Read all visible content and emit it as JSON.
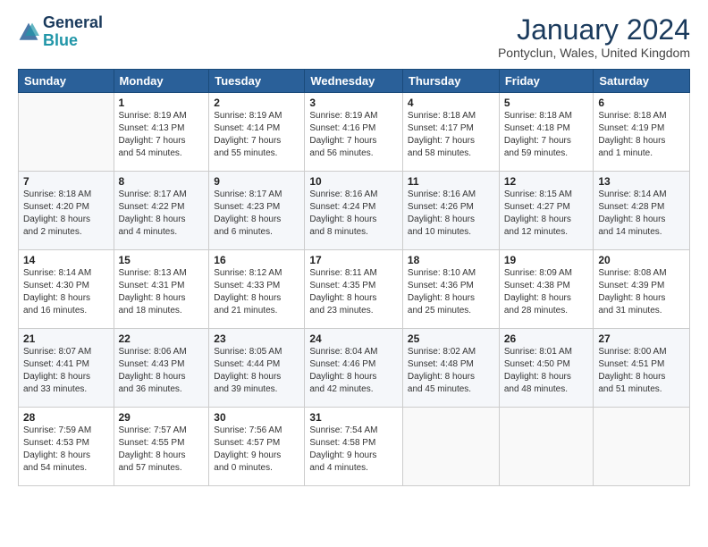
{
  "logo": {
    "line1": "General",
    "line2": "Blue"
  },
  "title": "January 2024",
  "location": "Pontyclun, Wales, United Kingdom",
  "headers": [
    "Sunday",
    "Monday",
    "Tuesday",
    "Wednesday",
    "Thursday",
    "Friday",
    "Saturday"
  ],
  "weeks": [
    [
      {
        "day": "",
        "info": ""
      },
      {
        "day": "1",
        "info": "Sunrise: 8:19 AM\nSunset: 4:13 PM\nDaylight: 7 hours\nand 54 minutes."
      },
      {
        "day": "2",
        "info": "Sunrise: 8:19 AM\nSunset: 4:14 PM\nDaylight: 7 hours\nand 55 minutes."
      },
      {
        "day": "3",
        "info": "Sunrise: 8:19 AM\nSunset: 4:16 PM\nDaylight: 7 hours\nand 56 minutes."
      },
      {
        "day": "4",
        "info": "Sunrise: 8:18 AM\nSunset: 4:17 PM\nDaylight: 7 hours\nand 58 minutes."
      },
      {
        "day": "5",
        "info": "Sunrise: 8:18 AM\nSunset: 4:18 PM\nDaylight: 7 hours\nand 59 minutes."
      },
      {
        "day": "6",
        "info": "Sunrise: 8:18 AM\nSunset: 4:19 PM\nDaylight: 8 hours\nand 1 minute."
      }
    ],
    [
      {
        "day": "7",
        "info": "Sunrise: 8:18 AM\nSunset: 4:20 PM\nDaylight: 8 hours\nand 2 minutes."
      },
      {
        "day": "8",
        "info": "Sunrise: 8:17 AM\nSunset: 4:22 PM\nDaylight: 8 hours\nand 4 minutes."
      },
      {
        "day": "9",
        "info": "Sunrise: 8:17 AM\nSunset: 4:23 PM\nDaylight: 8 hours\nand 6 minutes."
      },
      {
        "day": "10",
        "info": "Sunrise: 8:16 AM\nSunset: 4:24 PM\nDaylight: 8 hours\nand 8 minutes."
      },
      {
        "day": "11",
        "info": "Sunrise: 8:16 AM\nSunset: 4:26 PM\nDaylight: 8 hours\nand 10 minutes."
      },
      {
        "day": "12",
        "info": "Sunrise: 8:15 AM\nSunset: 4:27 PM\nDaylight: 8 hours\nand 12 minutes."
      },
      {
        "day": "13",
        "info": "Sunrise: 8:14 AM\nSunset: 4:28 PM\nDaylight: 8 hours\nand 14 minutes."
      }
    ],
    [
      {
        "day": "14",
        "info": "Sunrise: 8:14 AM\nSunset: 4:30 PM\nDaylight: 8 hours\nand 16 minutes."
      },
      {
        "day": "15",
        "info": "Sunrise: 8:13 AM\nSunset: 4:31 PM\nDaylight: 8 hours\nand 18 minutes."
      },
      {
        "day": "16",
        "info": "Sunrise: 8:12 AM\nSunset: 4:33 PM\nDaylight: 8 hours\nand 21 minutes."
      },
      {
        "day": "17",
        "info": "Sunrise: 8:11 AM\nSunset: 4:35 PM\nDaylight: 8 hours\nand 23 minutes."
      },
      {
        "day": "18",
        "info": "Sunrise: 8:10 AM\nSunset: 4:36 PM\nDaylight: 8 hours\nand 25 minutes."
      },
      {
        "day": "19",
        "info": "Sunrise: 8:09 AM\nSunset: 4:38 PM\nDaylight: 8 hours\nand 28 minutes."
      },
      {
        "day": "20",
        "info": "Sunrise: 8:08 AM\nSunset: 4:39 PM\nDaylight: 8 hours\nand 31 minutes."
      }
    ],
    [
      {
        "day": "21",
        "info": "Sunrise: 8:07 AM\nSunset: 4:41 PM\nDaylight: 8 hours\nand 33 minutes."
      },
      {
        "day": "22",
        "info": "Sunrise: 8:06 AM\nSunset: 4:43 PM\nDaylight: 8 hours\nand 36 minutes."
      },
      {
        "day": "23",
        "info": "Sunrise: 8:05 AM\nSunset: 4:44 PM\nDaylight: 8 hours\nand 39 minutes."
      },
      {
        "day": "24",
        "info": "Sunrise: 8:04 AM\nSunset: 4:46 PM\nDaylight: 8 hours\nand 42 minutes."
      },
      {
        "day": "25",
        "info": "Sunrise: 8:02 AM\nSunset: 4:48 PM\nDaylight: 8 hours\nand 45 minutes."
      },
      {
        "day": "26",
        "info": "Sunrise: 8:01 AM\nSunset: 4:50 PM\nDaylight: 8 hours\nand 48 minutes."
      },
      {
        "day": "27",
        "info": "Sunrise: 8:00 AM\nSunset: 4:51 PM\nDaylight: 8 hours\nand 51 minutes."
      }
    ],
    [
      {
        "day": "28",
        "info": "Sunrise: 7:59 AM\nSunset: 4:53 PM\nDaylight: 8 hours\nand 54 minutes."
      },
      {
        "day": "29",
        "info": "Sunrise: 7:57 AM\nSunset: 4:55 PM\nDaylight: 8 hours\nand 57 minutes."
      },
      {
        "day": "30",
        "info": "Sunrise: 7:56 AM\nSunset: 4:57 PM\nDaylight: 9 hours\nand 0 minutes."
      },
      {
        "day": "31",
        "info": "Sunrise: 7:54 AM\nSunset: 4:58 PM\nDaylight: 9 hours\nand 4 minutes."
      },
      {
        "day": "",
        "info": ""
      },
      {
        "day": "",
        "info": ""
      },
      {
        "day": "",
        "info": ""
      }
    ]
  ]
}
